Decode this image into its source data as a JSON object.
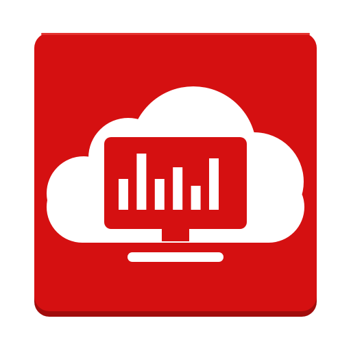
{
  "icon": {
    "name": "cloud-monitor-analytics-icon",
    "colors": {
      "tile": "#d51011",
      "tile_shadow": "#a10c0c",
      "tile_highlight": "#e4332f",
      "glyph": "#ffffff"
    },
    "bar_levels": [
      0.45,
      0.82,
      0.45,
      0.62,
      0.35,
      0.75
    ]
  }
}
